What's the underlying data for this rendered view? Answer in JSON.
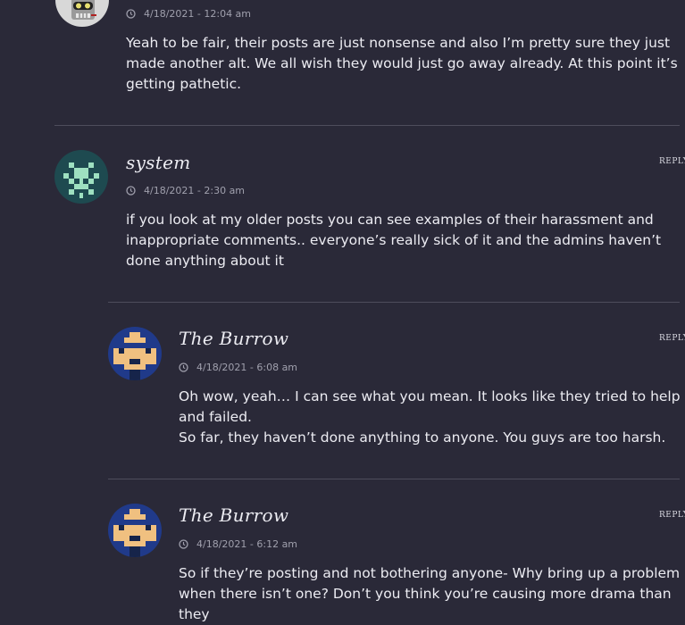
{
  "comments": [
    {
      "author": "",
      "timestamp": "4/18/2021 - 12:04 am",
      "text": [
        "Yeah to be fair, their posts are just nonsense and also I’m pretty sure they just made another alt. We all wish they would just go away already. At this point it’s getting pathetic."
      ],
      "avatar": "robot-avatar"
    },
    {
      "author": "system",
      "timestamp": "4/18/2021 - 2:30 am",
      "reply_label": "REPLY",
      "text": [
        "if you look at my older posts you can see examples of their harassment and inappropriate comments.. everyone’s really sick of it and the admins haven’t done anything about it"
      ],
      "avatar": "invader-avatar"
    },
    {
      "author": "The Burrow",
      "timestamp": "4/18/2021 - 6:08 am",
      "reply_label": "REPLY",
      "text": [
        "Oh wow, yeah… I can see what you mean. It looks like they tried to help and failed.",
        "So far, they haven’t done anything to anyone. You guys are too harsh."
      ],
      "avatar": "pixel-face-avatar"
    },
    {
      "author": "The Burrow",
      "timestamp": "4/18/2021 - 6:12 am",
      "reply_label": "REPLY",
      "text": [
        "So if they’re posting and not bothering anyone- Why bring up a problem when there isn’t one? Don’t you think you’re causing more drama than they"
      ],
      "avatar": "pixel-face-avatar"
    }
  ],
  "colors": {
    "background": "#2a2938",
    "text": "#ececf2",
    "meta": "#a0a0ad",
    "divider": "#4e4d5c",
    "invader_bg": "#1e4a50",
    "invader_fg": "#9ee0c0",
    "burrow_bg": "#203a8a",
    "burrow_face": "#f0c080"
  }
}
